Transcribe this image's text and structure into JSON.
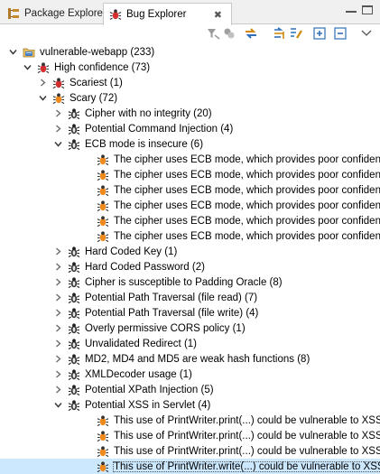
{
  "tabs": {
    "package_explorer": "Package Explorer",
    "bug_explorer": "Bug Explorer",
    "close_glyph": "✖"
  },
  "colors": {
    "selection": "#cce8ff",
    "bug_red": "#d32f2f",
    "bug_orange": "#f08a1c",
    "bug_dark": "#3a3a3a",
    "accent_blue": "#2f6fb8"
  },
  "toolbar_icons": [
    "filter-icon",
    "group-icon",
    "sync-icon",
    "link-icon",
    "pen-icon",
    "expand-all-icon",
    "collapse-all-icon",
    "view-menu-icon"
  ],
  "tree": [
    {
      "label": "vulnerable-webapp (233)",
      "icon": "project-icon",
      "expanded": true
    },
    {
      "label": "High confidence (73)",
      "icon": "red-bug-icon",
      "expanded": true
    },
    {
      "label": "Scariest (1)",
      "icon": "red-bug-icon",
      "expanded": false
    },
    {
      "label": "Scary (72)",
      "icon": "orange-bug-icon",
      "expanded": true
    },
    {
      "label": "Cipher with no integrity (20)",
      "icon": "dark-bug-icon",
      "expanded": false
    },
    {
      "label": "Potential Command Injection (4)",
      "icon": "dark-bug-icon",
      "expanded": false
    },
    {
      "label": "ECB mode is insecure (6)",
      "icon": "dark-bug-icon",
      "expanded": true
    },
    {
      "label": "The cipher uses ECB mode, which provides poor confidential",
      "icon": "orange-bug-icon",
      "expanded": null
    },
    {
      "label": "The cipher uses ECB mode, which provides poor confidential",
      "icon": "orange-bug-icon",
      "expanded": null
    },
    {
      "label": "The cipher uses ECB mode, which provides poor confidential",
      "icon": "orange-bug-icon",
      "expanded": null
    },
    {
      "label": "The cipher uses ECB mode, which provides poor confidential",
      "icon": "orange-bug-icon",
      "expanded": null
    },
    {
      "label": "The cipher uses ECB mode, which provides poor confidential",
      "icon": "orange-bug-icon",
      "expanded": null
    },
    {
      "label": "The cipher uses ECB mode, which provides poor confidential",
      "icon": "orange-bug-icon",
      "expanded": null
    },
    {
      "label": "Hard Coded Key (1)",
      "icon": "dark-bug-icon",
      "expanded": false
    },
    {
      "label": "Hard Coded Password (2)",
      "icon": "dark-bug-icon",
      "expanded": false
    },
    {
      "label": "Cipher is susceptible to Padding Oracle (8)",
      "icon": "dark-bug-icon",
      "expanded": false
    },
    {
      "label": "Potential Path Traversal (file read) (7)",
      "icon": "dark-bug-icon",
      "expanded": false
    },
    {
      "label": "Potential Path Traversal (file write) (4)",
      "icon": "dark-bug-icon",
      "expanded": false
    },
    {
      "label": "Overly permissive CORS policy (1)",
      "icon": "dark-bug-icon",
      "expanded": false
    },
    {
      "label": "Unvalidated Redirect (1)",
      "icon": "dark-bug-icon",
      "expanded": false
    },
    {
      "label": "MD2, MD4 and MD5 are weak hash functions (8)",
      "icon": "dark-bug-icon",
      "expanded": false
    },
    {
      "label": "XMLDecoder usage (1)",
      "icon": "dark-bug-icon",
      "expanded": false
    },
    {
      "label": "Potential XPath Injection (5)",
      "icon": "dark-bug-icon",
      "expanded": false
    },
    {
      "label": "Potential XSS in Servlet (4)",
      "icon": "dark-bug-icon",
      "expanded": true
    },
    {
      "label": "This use of PrintWriter.print(...) could be vulnerable to XSS [S",
      "icon": "orange-bug-icon",
      "expanded": null
    },
    {
      "label": "This use of PrintWriter.print(...) could be vulnerable to XSS [S",
      "icon": "orange-bug-icon",
      "expanded": null
    },
    {
      "label": "This use of PrintWriter.print(...) could be vulnerable to XSS [S",
      "icon": "orange-bug-icon",
      "expanded": null
    },
    {
      "label": "This use of PrintWriter.write(...) could be vulnerable to XSS [S",
      "icon": "orange-bug-icon",
      "expanded": null,
      "selected": true
    }
  ]
}
